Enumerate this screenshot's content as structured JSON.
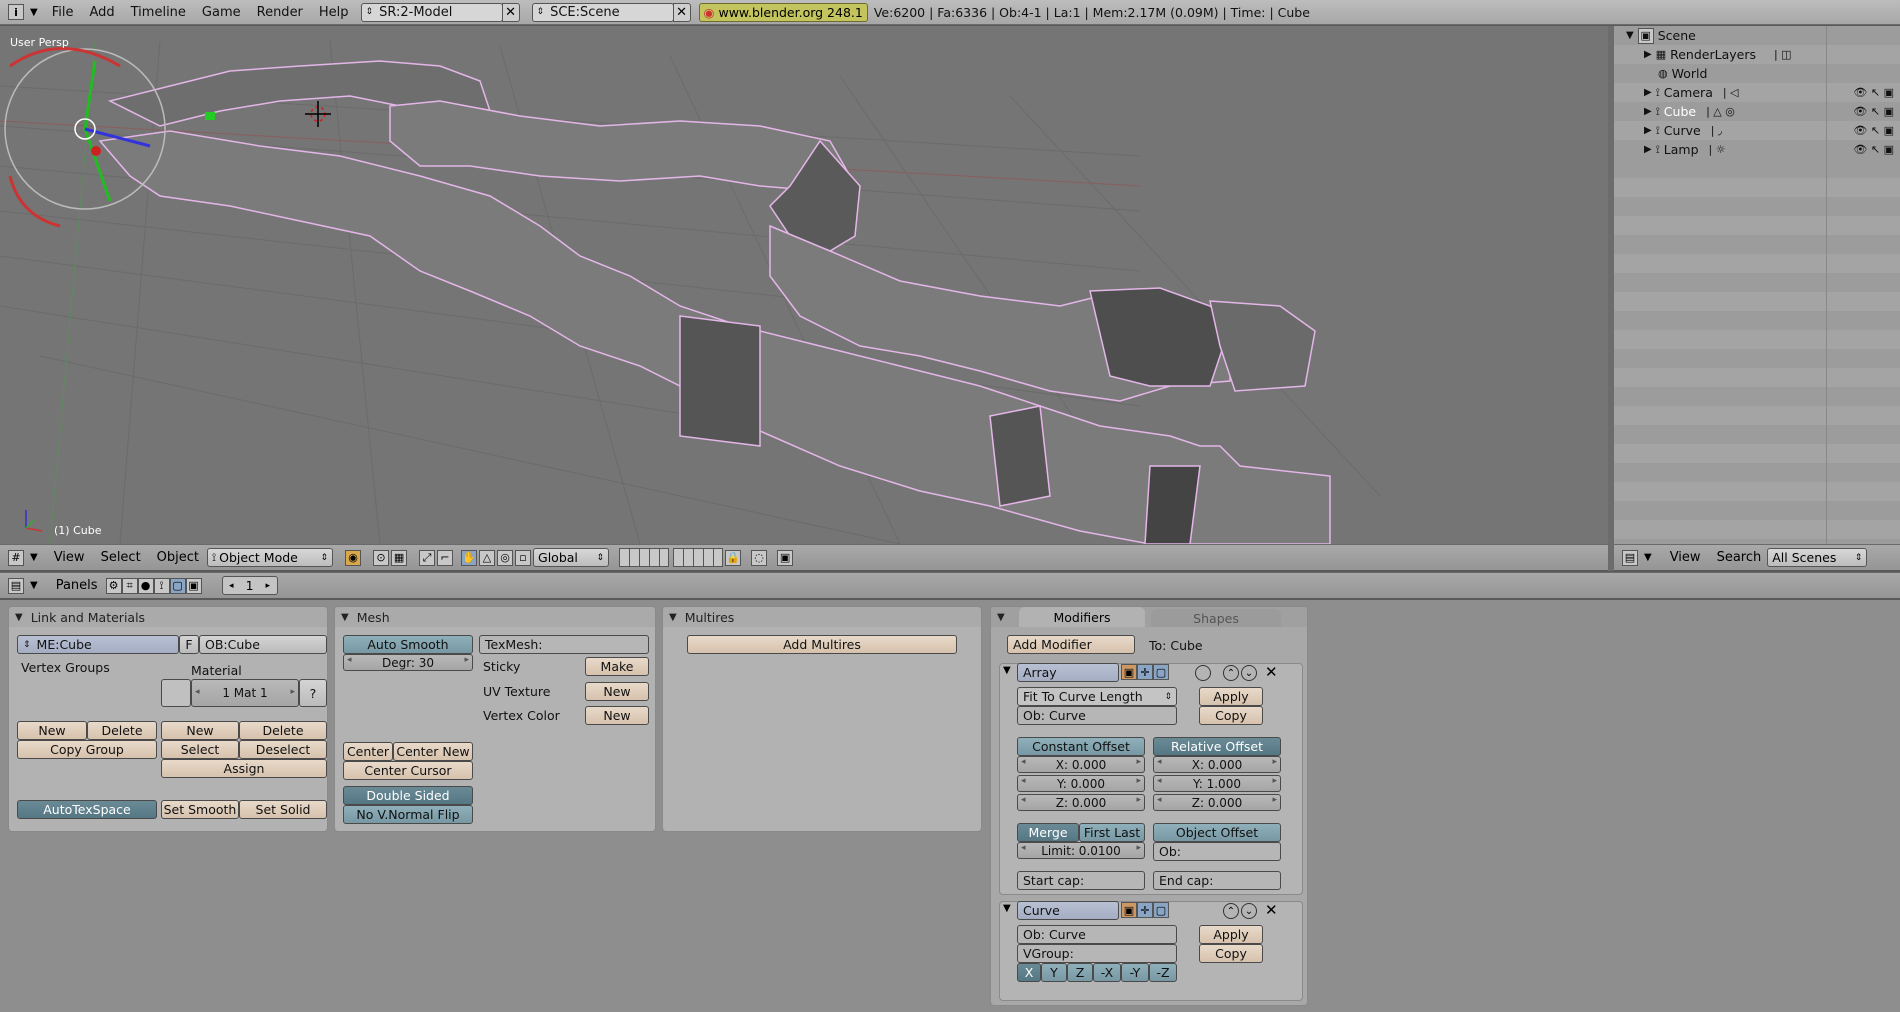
{
  "topbar": {
    "menus": [
      "File",
      "Add",
      "Timeline",
      "Game",
      "Render",
      "Help"
    ],
    "screen": "SR:2-Model",
    "scene": "SCE:Scene",
    "version_badge": "www.blender.org 248.1",
    "stats": "Ve:6200 | Fa:6336 | Ob:4-1 | La:1  | Mem:2.17M (0.09M)  | Time: | Cube"
  },
  "viewport": {
    "view_label": "User Persp",
    "object_label": "(1) Cube"
  },
  "outliner": {
    "items": [
      {
        "label": "Scene"
      },
      {
        "label": "RenderLayers"
      },
      {
        "label": "World"
      },
      {
        "label": "Camera"
      },
      {
        "label": "Cube"
      },
      {
        "label": "Curve"
      },
      {
        "label": "Lamp"
      }
    ]
  },
  "view3d_header": {
    "menus": [
      "View",
      "Select",
      "Object"
    ],
    "mode": "Object Mode",
    "orientation": "Global"
  },
  "outliner_header": {
    "menus": [
      "View",
      "Search"
    ],
    "scenes": "All Scenes"
  },
  "buttons_header": {
    "panels_label": "Panels",
    "frame": "1"
  },
  "link_materials": {
    "title": "Link and Materials",
    "mesh_name": "ME:Cube",
    "f_label": "F",
    "object_name": "OB:Cube",
    "vertex_groups": "Vertex Groups",
    "material": "Material",
    "mat_field": "1 Mat 1",
    "q_label": "?",
    "new": "New",
    "delete": "Delete",
    "copy_group": "Copy Group",
    "mat_new": "New",
    "mat_delete": "Delete",
    "select": "Select",
    "deselect": "Deselect",
    "assign": "Assign",
    "autotexspace": "AutoTexSpace",
    "set_smooth": "Set Smooth",
    "set_solid": "Set Solid"
  },
  "mesh": {
    "title": "Mesh",
    "auto_smooth": "Auto Smooth",
    "degr": "Degr: 30",
    "texmesh": "TexMesh:",
    "sticky": "Sticky",
    "make": "Make",
    "uv_texture": "UV Texture",
    "uv_new": "New",
    "vertex_color": "Vertex Color",
    "vc_new": "New",
    "center": "Center",
    "center_new": "Center New",
    "center_cursor": "Center Cursor",
    "double_sided": "Double Sided",
    "no_vnormal_flip": "No V.Normal Flip"
  },
  "multires": {
    "title": "Multires",
    "add_multires": "Add Multires"
  },
  "modifiers": {
    "tab_modifiers": "Modifiers",
    "tab_shapes": "Shapes",
    "add_modifier": "Add Modifier",
    "to": "To: Cube",
    "array": {
      "name": "Array",
      "fit_type": "Fit To Curve Length",
      "ob": "Ob: Curve",
      "apply": "Apply",
      "copy": "Copy",
      "constant_offset": "Constant Offset",
      "relative_offset": "Relative Offset",
      "cx": "X: 0.000",
      "cy": "Y: 0.000",
      "cz": "Z: 0.000",
      "rx": "X: 0.000",
      "ry": "Y: 1.000",
      "rz": "Z: 0.000",
      "merge": "Merge",
      "first_last": "First Last",
      "object_offset": "Object Offset",
      "limit": "Limit: 0.0100",
      "ob_empty": "Ob:",
      "start_cap": "Start cap:",
      "end_cap": "End cap:"
    },
    "curve": {
      "name": "Curve",
      "ob": "Ob: Curve",
      "vgroup": "VGroup:",
      "apply": "Apply",
      "copy": "Copy",
      "axes": [
        "X",
        "Y",
        "Z",
        "-X",
        "-Y",
        "-Z"
      ]
    }
  }
}
